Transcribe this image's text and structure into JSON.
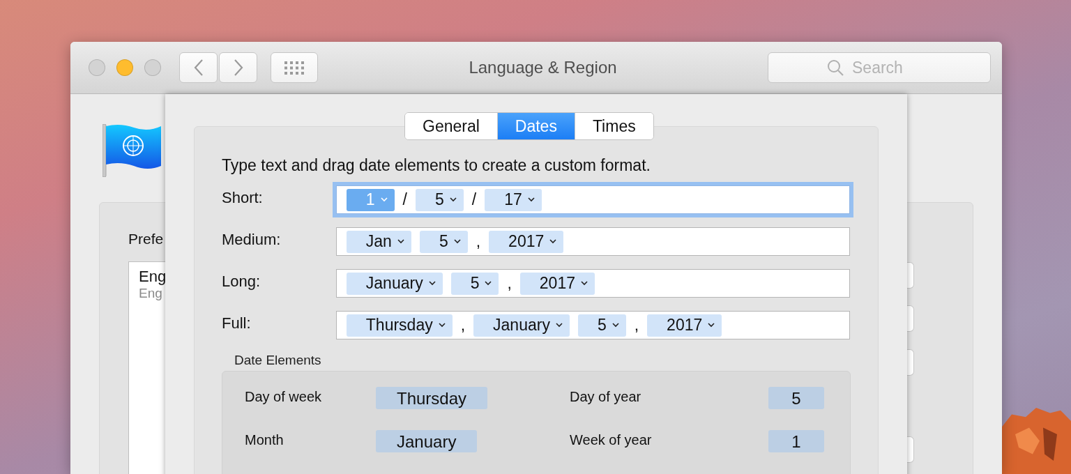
{
  "window": {
    "title": "Language & Region",
    "controls": [
      {
        "color": "#d3d3d3"
      },
      {
        "color": "#febc2e"
      },
      {
        "color": "#d3d3d3"
      }
    ],
    "search": {
      "placeholder": "Search"
    }
  },
  "background_pane": {
    "section_title": "Prefe",
    "languages": [
      {
        "name": "Eng",
        "subtitle": "Eng"
      }
    ]
  },
  "sheet": {
    "tabs": [
      {
        "label": "General",
        "selected": false
      },
      {
        "label": "Dates",
        "selected": true
      },
      {
        "label": "Times",
        "selected": false
      }
    ],
    "instruction": "Type text and drag date elements to create a custom format.",
    "formats": [
      {
        "label": "Short:",
        "focused": true,
        "parts": [
          {
            "kind": "token",
            "text": "1",
            "selected": true
          },
          {
            "kind": "separator",
            "text": "/"
          },
          {
            "kind": "token",
            "text": "5",
            "selected": false
          },
          {
            "kind": "separator",
            "text": "/"
          },
          {
            "kind": "token",
            "text": "17",
            "selected": false
          }
        ]
      },
      {
        "label": "Medium:",
        "focused": false,
        "parts": [
          {
            "kind": "token",
            "text": "Jan",
            "selected": false
          },
          {
            "kind": "token",
            "text": "5",
            "selected": false
          },
          {
            "kind": "separator",
            "text": ","
          },
          {
            "kind": "token",
            "text": "2017",
            "selected": false
          }
        ]
      },
      {
        "label": "Long:",
        "focused": false,
        "parts": [
          {
            "kind": "token",
            "text": "January",
            "selected": false
          },
          {
            "kind": "token",
            "text": "5",
            "selected": false
          },
          {
            "kind": "separator",
            "text": ","
          },
          {
            "kind": "token",
            "text": "2017",
            "selected": false
          }
        ]
      },
      {
        "label": "Full:",
        "focused": false,
        "parts": [
          {
            "kind": "token",
            "text": "Thursday",
            "selected": false
          },
          {
            "kind": "separator",
            "text": ","
          },
          {
            "kind": "token",
            "text": "January",
            "selected": false
          },
          {
            "kind": "token",
            "text": "5",
            "selected": false
          },
          {
            "kind": "separator",
            "text": ","
          },
          {
            "kind": "token",
            "text": "2017",
            "selected": false
          }
        ]
      }
    ],
    "date_elements": {
      "title": "Date Elements",
      "items": [
        {
          "label": "Day of week",
          "value": "Thursday"
        },
        {
          "label": "Day of year",
          "value": "5"
        },
        {
          "label": "Month",
          "value": "January"
        },
        {
          "label": "Week of year",
          "value": "1"
        }
      ]
    }
  }
}
